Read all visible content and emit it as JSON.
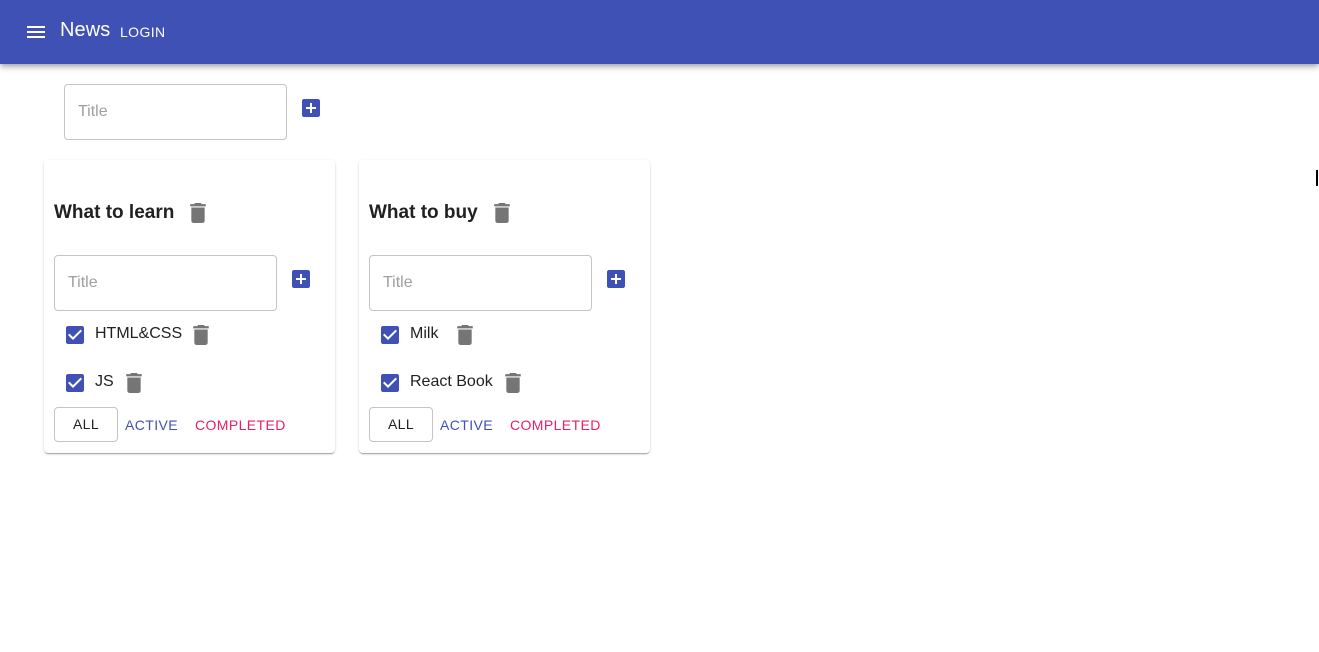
{
  "appbar": {
    "title": "News",
    "login_label": "LOGIN",
    "background": "#3f51b5",
    "menu_icon": "menu-icon"
  },
  "add_list": {
    "placeholder": "Title",
    "add_icon": "add-box-icon"
  },
  "todolists": [
    {
      "title": "What to learn",
      "input_placeholder": "Title",
      "tasks": [
        {
          "label": "HTML&CSS",
          "checked": true
        },
        {
          "label": "JS",
          "checked": true
        }
      ],
      "filters": {
        "all": "ALL",
        "active": "ACTIVE",
        "completed": "COMPLETED"
      }
    },
    {
      "title": "What to buy",
      "input_placeholder": "Title",
      "tasks": [
        {
          "label": "Milk",
          "checked": true
        },
        {
          "label": "React Book",
          "checked": true
        }
      ],
      "filters": {
        "all": "ALL",
        "active": "ACTIVE",
        "completed": "COMPLETED"
      }
    }
  ],
  "colors": {
    "primary": "#3f51b5",
    "secondary": "#e91e63",
    "icon_gray": "#757575"
  }
}
